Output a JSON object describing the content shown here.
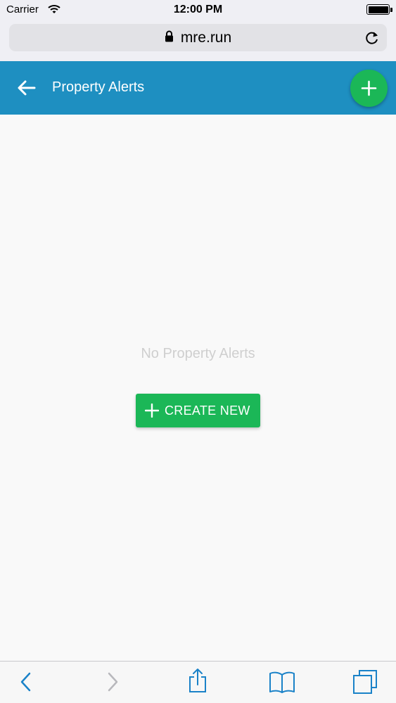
{
  "status_bar": {
    "carrier": "Carrier",
    "time": "12:00 PM",
    "battery_level": 1.0
  },
  "browser": {
    "url": "mre.run",
    "icons": {
      "lock": "lock-icon",
      "reload": "reload-icon"
    }
  },
  "app_bar": {
    "title": "Property Alerts",
    "color": "#1e8fc1",
    "icons": {
      "back": "arrow-left-icon",
      "add": "plus-icon"
    }
  },
  "empty_state": {
    "message": "No Property Alerts",
    "create_label": "CREATE NEW",
    "accent": "#1bb757"
  },
  "toolbar": {
    "icons": [
      "chevron-left-icon",
      "chevron-right-icon",
      "share-icon",
      "bookmarks-icon",
      "tabs-icon"
    ],
    "tint": "#1a82c8"
  }
}
